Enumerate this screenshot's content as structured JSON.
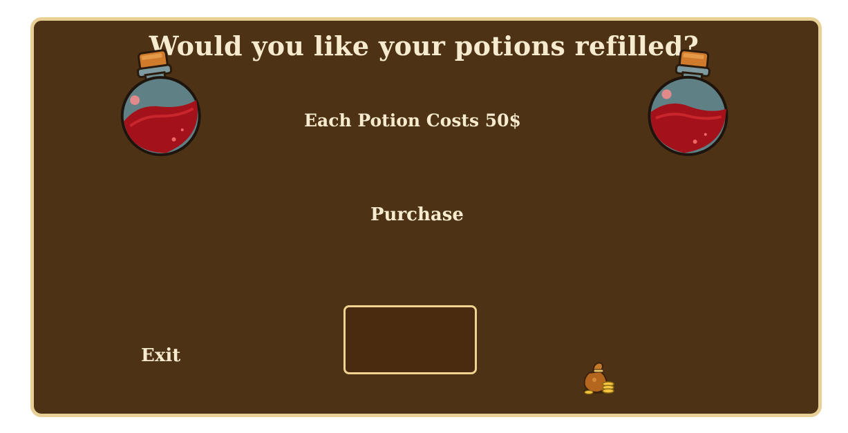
{
  "dialog": {
    "title": "Would you like your potions refilled?",
    "cost_text": "Each Potion Costs 50$",
    "purchase_label": "Purchase",
    "exit_label": "Exit",
    "quantity_box_value": ""
  },
  "icons": {
    "left_potion": "red-potion-icon",
    "right_potion": "red-potion-icon",
    "money": "money-bag-icon"
  },
  "colors": {
    "panel_bg": "#4d3215",
    "panel_border": "#e8cf95",
    "text": "#f7ebcf",
    "potion_liquid": "#a3121a"
  }
}
